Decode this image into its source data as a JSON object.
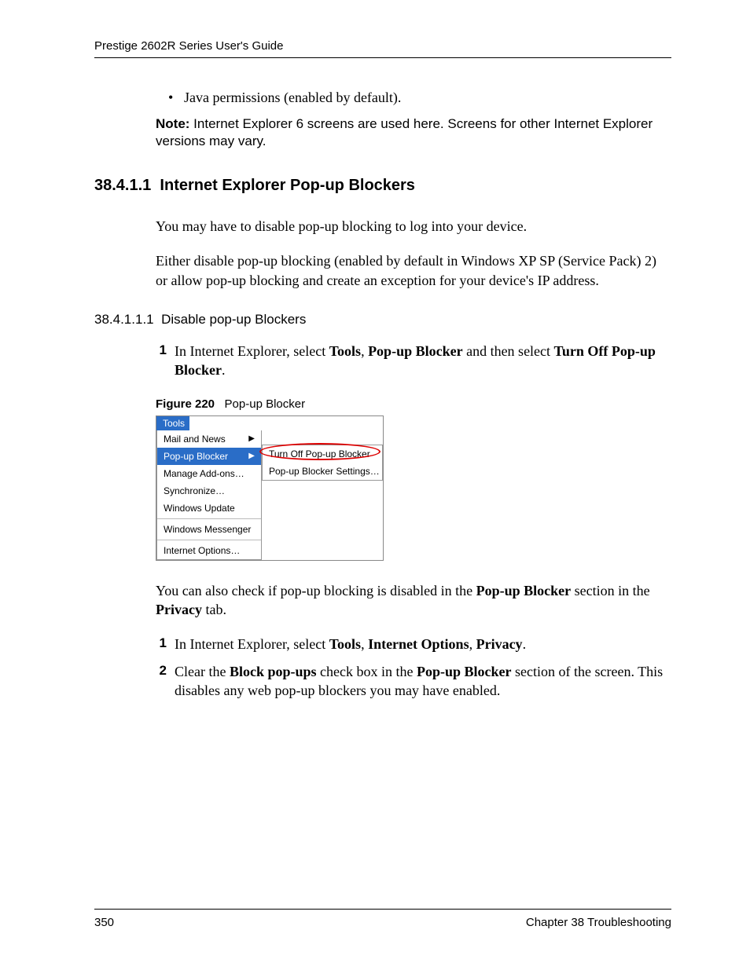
{
  "header": {
    "title": "Prestige 2602R Series User's Guide"
  },
  "bullet": {
    "text": "Java permissions (enabled by default)."
  },
  "note": {
    "label": "Note:",
    "text": " Internet Explorer 6 screens are used here. Screens for other Internet Explorer versions may vary."
  },
  "section": {
    "num": "38.4.1.1",
    "title": "Internet Explorer Pop-up Blockers",
    "p1": "You may have to disable pop-up blocking to log into your device.",
    "p2": "Either disable pop-up blocking (enabled by default in Windows XP SP (Service Pack) 2) or allow pop-up blocking and create an exception for your device's IP address."
  },
  "subsection": {
    "num": "38.4.1.1.1",
    "title": "Disable pop-up Blockers"
  },
  "step1": {
    "num": "1",
    "t1": "In Internet Explorer, select ",
    "b1": "Tools",
    "t2": ", ",
    "b2": "Pop-up Blocker",
    "t3": " and then select ",
    "b3": "Turn Off Pop-up Blocker",
    "t4": "."
  },
  "figure": {
    "label": "Figure 220",
    "caption": "Pop-up Blocker",
    "tools": "Tools",
    "menu": {
      "mail_and_news": "Mail and News",
      "popup_blocker": "Pop-up Blocker",
      "manage_addons": "Manage Add-ons…",
      "synchronize": "Synchronize…",
      "windows_update": "Windows Update",
      "windows_messenger": "Windows Messenger",
      "internet_options": "Internet Options…"
    },
    "submenu": {
      "turn_off": "Turn Off Pop-up Blocker",
      "settings": "Pop-up Blocker Settings…"
    }
  },
  "after_figure": {
    "t1": "You can also check if pop-up blocking is disabled in the ",
    "b1": "Pop-up Blocker",
    "t2": " section in the ",
    "b2": "Privacy",
    "t3": " tab."
  },
  "step2": {
    "num": "1",
    "t1": "In Internet Explorer, select ",
    "b1": "Tools",
    "t2": ", ",
    "b2": "Internet Options",
    "t3": ", ",
    "b3": "Privacy",
    "t4": "."
  },
  "step3": {
    "num": "2",
    "t1": "Clear the ",
    "b1": "Block pop-ups",
    "t2": " check box in the ",
    "b2": "Pop-up Blocker",
    "t3": " section of the screen. This disables any web pop-up blockers you may have enabled."
  },
  "footer": {
    "page": "350",
    "chapter": "Chapter 38 Troubleshooting"
  }
}
